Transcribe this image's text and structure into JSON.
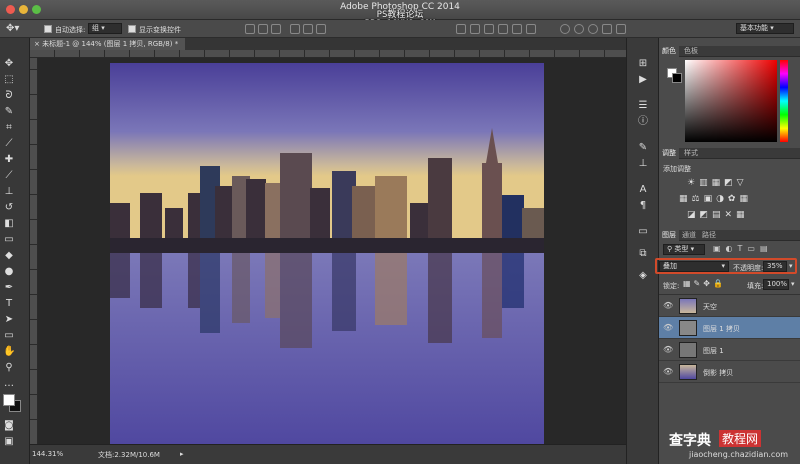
{
  "app": {
    "title": "Adobe Photoshop CC 2014",
    "watermark": "PS教程论坛\nBBS.16XX8.COM"
  },
  "options": {
    "auto_select_label": "自动选择:",
    "auto_select_value": "组",
    "show_transform_label": "显示变换控件",
    "workspace": "基本功能"
  },
  "document": {
    "tab_title": "未标题-1 @ 144% (图层 1 拷贝, RGB/8) *"
  },
  "status": {
    "zoom": "144.31%",
    "doc_size": "文档:2.32M/10.6M"
  },
  "color_panel": {
    "tabs": [
      "颜色",
      "色板"
    ]
  },
  "adjust_panel": {
    "tabs": [
      "调整",
      "样式"
    ],
    "title": "添加调整"
  },
  "layers_panel": {
    "tabs": [
      "图层",
      "通道",
      "路径"
    ],
    "filter_kind": "类型",
    "blend_mode": "叠加",
    "opacity_label": "不透明度:",
    "opacity_value": "35%",
    "lock_label": "锁定:",
    "fill_label": "填充:",
    "fill_value": "100%",
    "layers": [
      {
        "name": "天空",
        "selected": false
      },
      {
        "name": "图层 1 拷贝",
        "selected": true
      },
      {
        "name": "图层 1",
        "selected": false
      },
      {
        "name": "倒影 拷贝",
        "selected": false
      }
    ]
  },
  "bottom_watermark": {
    "brand": "查字典",
    "suffix": "教程网",
    "url": "jiaocheng.chazidian.com"
  },
  "colors": {
    "highlight": "#d24a2a",
    "selected_layer": "#5e7fa6"
  }
}
